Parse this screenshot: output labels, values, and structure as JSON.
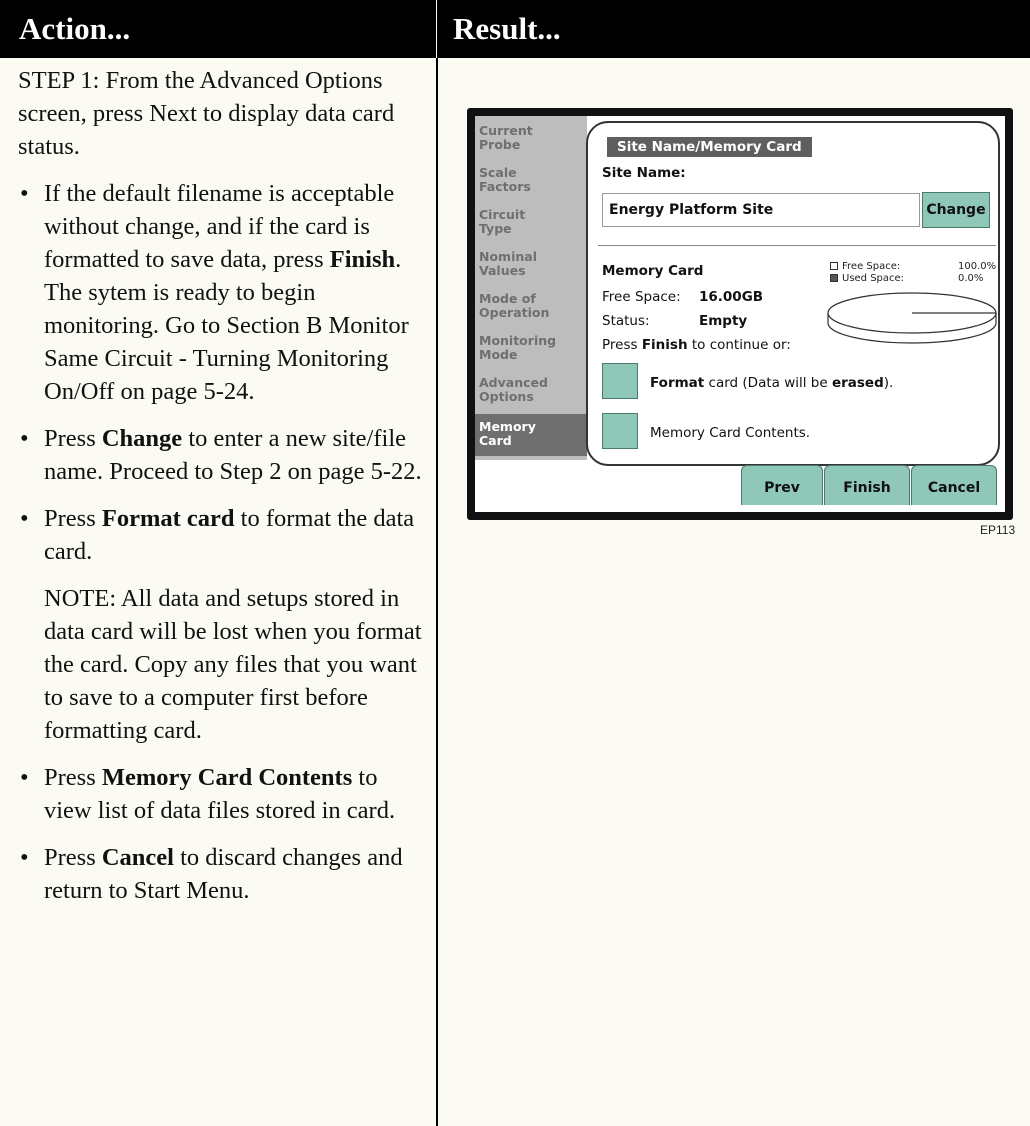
{
  "header": {
    "left": "Action...",
    "right": "Result..."
  },
  "instructions": {
    "step1": "STEP 1: From the Advanced Options screen, press Next to display data card status.",
    "bullet1_pre": "If the default filename is acceptable without change, and if the card is formatted to save data, press ",
    "bullet1_bold": "Finish",
    "bullet1_post": ". The sytem is ready to begin monitoring. Go to Section B Monitor Same Circuit - Turning Monitoring On/Off on page 5-24.",
    "bullet2_pre": "Press ",
    "bullet2_bold": "Change",
    "bullet2_post": " to enter a new site/file name. Proceed to Step 2 on page 5-22.",
    "bullet3_pre": "Press ",
    "bullet3_bold": "Format card",
    "bullet3_post": " to format the data card.",
    "note": "NOTE: All data and setups stored in data card will be lost when you format the card. Copy any files that you want to save to a computer first before formatting card.",
    "bullet4_pre": "Press ",
    "bullet4_bold": "Memory Card Contents",
    "bullet4_post": " to view list of data files stored in card.",
    "bullet5_pre": "Press ",
    "bullet5_bold": "Cancel",
    "bullet5_post": " to discard changes and return to Start Menu.",
    "bullet_glyph": "•"
  },
  "device": {
    "sidebar": [
      "Current\nProbe",
      "Scale\nFactors",
      "Circuit\nType",
      "Nominal\nValues",
      "Mode of\nOperation",
      "Monitoring\nMode",
      "Advanced\nOptions",
      "Memory\nCard"
    ],
    "panel_title": "Site Name/Memory Card",
    "site_name_label": "Site Name:",
    "site_name_value": "Energy Platform Site",
    "change_button": "Change",
    "memory_card_label": "Memory Card",
    "free_space_legend": "Free Space:",
    "free_space_pct": "100.0%",
    "used_space_legend": "Used Space:",
    "used_space_pct": "0.0%",
    "free_space_label": "Free Space:",
    "free_space_value": "16.00GB",
    "status_label": "Status:",
    "status_value": "Empty",
    "press_finish_pre": "Press ",
    "press_finish_bold": "Finish",
    "press_finish_post": " to continue or:",
    "format_bold": "Format",
    "format_mid": " card (Data will be ",
    "format_erased": "erased",
    "format_end": ").",
    "contents_label": "Memory Card Contents.",
    "prev_button": "Prev",
    "finish_button": "Finish",
    "cancel_button": "Cancel",
    "pie": {
      "free_fraction": 1.0,
      "used_fraction": 0.0
    }
  },
  "figure_caption": "EP113"
}
